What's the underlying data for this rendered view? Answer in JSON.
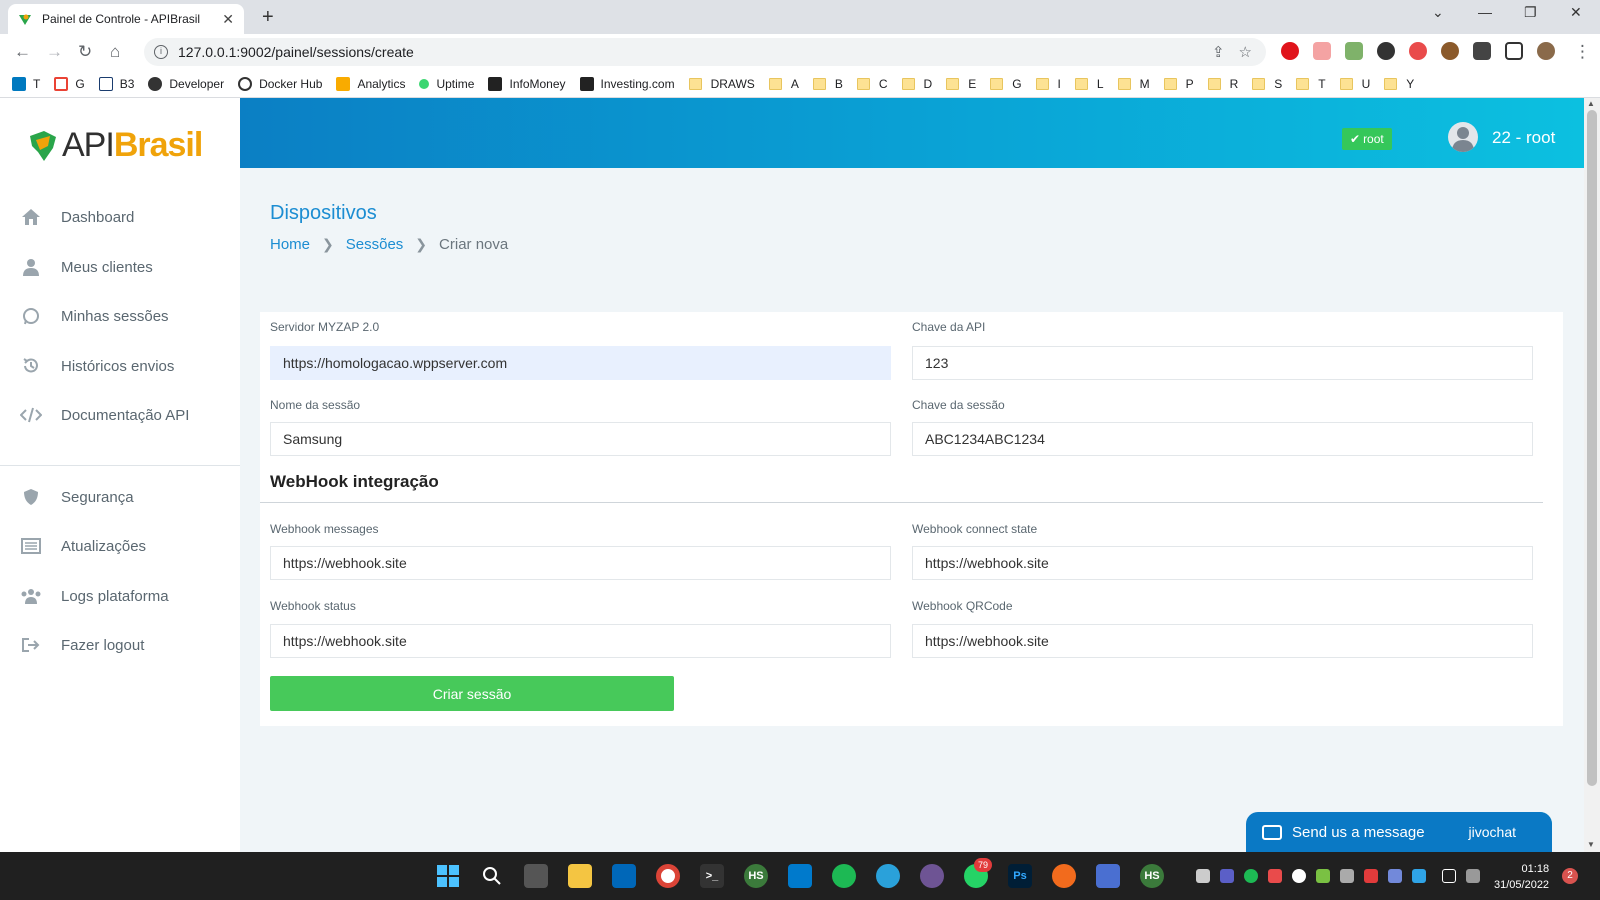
{
  "browser": {
    "tab_title": "Painel de Controle - APIBrasil",
    "url": "127.0.0.1:9002/painel/sessions/create",
    "bookmarks": [
      "T",
      "G",
      "B3",
      "Developer",
      "Docker Hub",
      "Analytics",
      "Uptime",
      "InfoMoney",
      "Investing.com"
    ],
    "bookmark_folders": [
      "DRAWS",
      "A",
      "B",
      "C",
      "D",
      "E",
      "G",
      "I",
      "L",
      "M",
      "P",
      "R",
      "S",
      "T",
      "U",
      "Y"
    ]
  },
  "brand": {
    "part1": "API",
    "part2": "Brasil"
  },
  "sidebar": {
    "items": [
      {
        "label": "Dashboard",
        "icon": "home-icon"
      },
      {
        "label": "Meus clientes",
        "icon": "user-icon"
      },
      {
        "label": "Minhas sessões",
        "icon": "whatsapp-icon"
      },
      {
        "label": "Históricos envios",
        "icon": "history-icon"
      },
      {
        "label": "Documentação API",
        "icon": "code-icon"
      },
      {
        "label": "Segurança",
        "icon": "shield-icon"
      },
      {
        "label": "Atualizações",
        "icon": "list-icon"
      },
      {
        "label": "Logs plataforma",
        "icon": "users-icon"
      },
      {
        "label": "Fazer logout",
        "icon": "logout-icon"
      }
    ]
  },
  "header": {
    "badge": "root",
    "user": "22 - root"
  },
  "page": {
    "title": "Dispositivos",
    "breadcrumb": [
      "Home",
      "Sessões",
      "Criar nova"
    ]
  },
  "form": {
    "server_label": "Servidor MYZAP 2.0",
    "server_value": "https://homologacao.wppserver.com",
    "api_key_label": "Chave da API",
    "api_key_value": "123",
    "session_name_label": "Nome da sessão",
    "session_name_value": "Samsung",
    "session_key_label": "Chave da sessão",
    "session_key_value": "ABC1234ABC1234",
    "webhook_section": "WebHook integração",
    "wh_messages_label": "Webhook messages",
    "wh_messages_value": "https://webhook.site",
    "wh_connect_label": "Webhook connect state",
    "wh_connect_value": "https://webhook.site",
    "wh_status_label": "Webhook status",
    "wh_status_value": "https://webhook.site",
    "wh_qrcode_label": "Webhook QRCode",
    "wh_qrcode_value": "https://webhook.site",
    "submit_label": "Criar sessão"
  },
  "chat": {
    "label": "Send us a message",
    "brand": "jivochat"
  },
  "taskbar": {
    "time": "01:18",
    "date": "31/05/2022",
    "notifications": "2",
    "whatsapp_badge": "79"
  },
  "colors": {
    "accent": "#1c8dd2",
    "header_start": "#0b7fc4",
    "header_end": "#0cc0e0",
    "success": "#47c95a",
    "brand_orange": "#f0a30a"
  }
}
